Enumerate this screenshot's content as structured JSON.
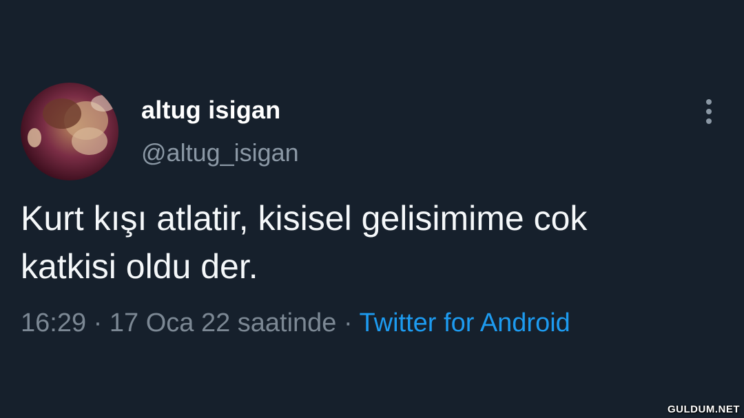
{
  "tweet": {
    "author": {
      "display_name": "altug isigan",
      "handle": "@altug_isigan",
      "avatar_icon": "profile-photo"
    },
    "text_lines": [
      "Kurt kışı atlatir, kisisel gelisimime cok",
      "katkisi oldu der."
    ],
    "time": "16:29",
    "separator": "·",
    "date": "17 Oca 22 saatinde",
    "source": "Twitter for Android",
    "more_icon": "vertical-ellipsis-icon"
  },
  "watermark": "GULDUM.NET",
  "colors": {
    "background": "#16202c",
    "text": "#f5f8fa",
    "muted": "#8b98a5",
    "accent": "#1d9bf0"
  }
}
